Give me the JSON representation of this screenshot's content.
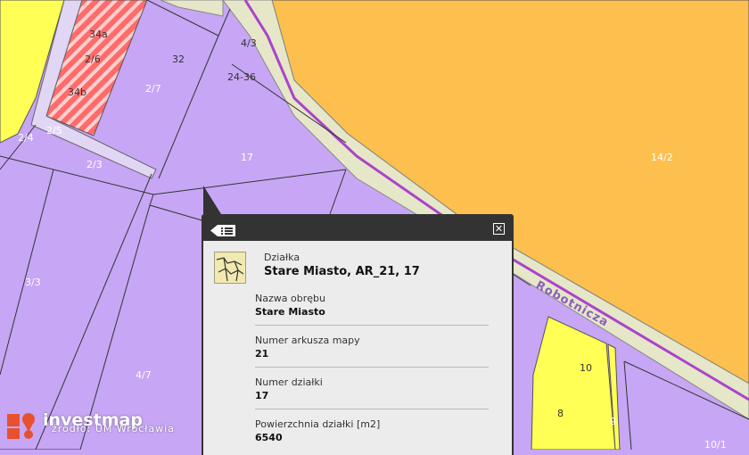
{
  "map": {
    "parcel_labels": [
      "34a",
      "2/6",
      "34b",
      "32",
      "2/7",
      "4/3",
      "24-36",
      "2/5",
      "2/4",
      "2/3",
      "17",
      "14/2",
      "3/3",
      "4/7",
      "10",
      "8",
      "9",
      "10/1"
    ],
    "street_name": "Robotnicza",
    "colors": {
      "residential": "#c7a6f5",
      "commercial": "#fdc04e",
      "green": "#ffff55",
      "road": "#e6e7c8",
      "road_line": "#aa44cc",
      "hatched": "#ff6b6b"
    }
  },
  "popup": {
    "type_label": "Działka",
    "title": "Stare Miasto, AR_21, 17",
    "fields": [
      {
        "label": "Nazwa obrębu",
        "value": "Stare Miasto"
      },
      {
        "label": "Numer arkusza mapy",
        "value": "21"
      },
      {
        "label": "Numer działki",
        "value": "17"
      },
      {
        "label": "Powierzchnia działki [m2]",
        "value": "6540"
      }
    ],
    "icons": {
      "menu": "list-icon",
      "close": "close-icon",
      "thumbnail": "parcel-thumbnail-icon"
    }
  },
  "brand": {
    "name": "investmap",
    "source": "źródło: UM Wrocławia",
    "color": "#e8502e"
  }
}
